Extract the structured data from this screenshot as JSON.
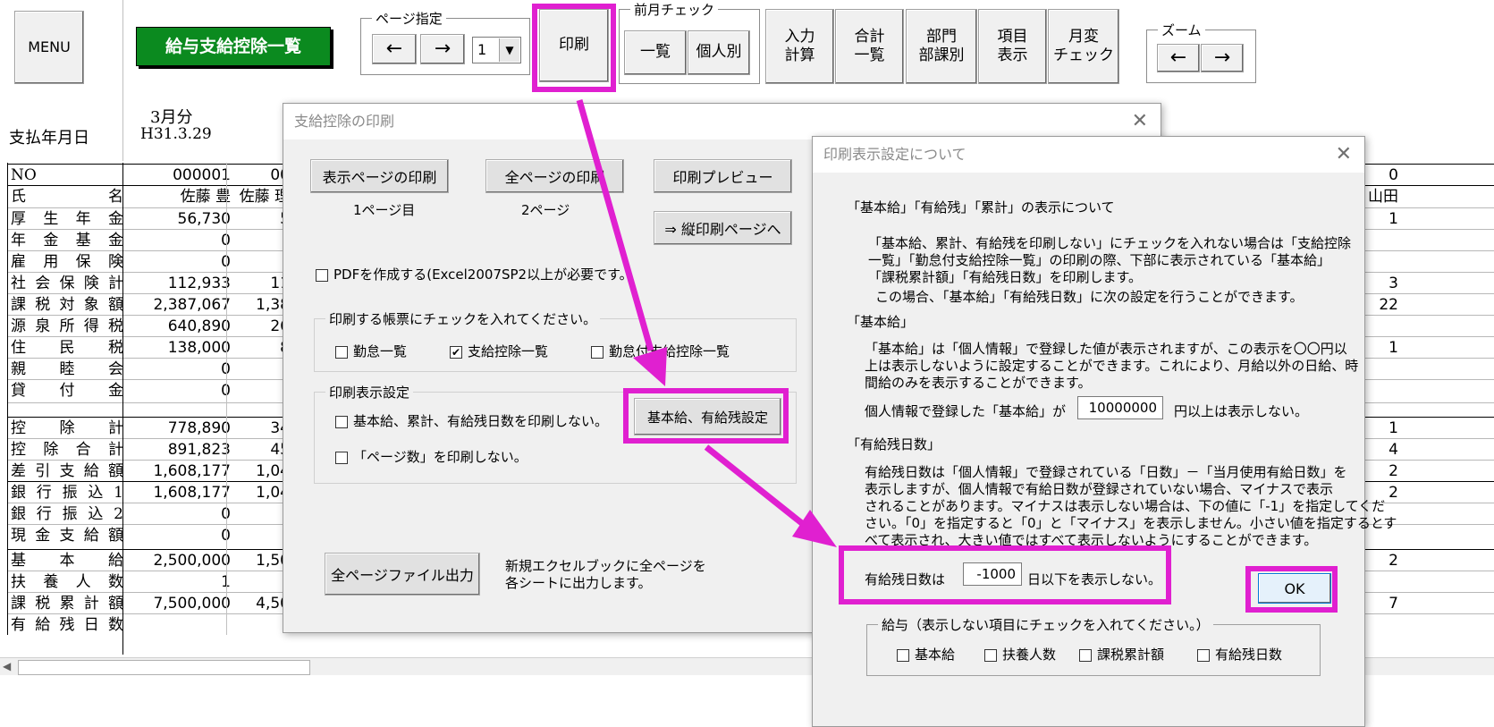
{
  "toolbar": {
    "menu": "MENU",
    "sheet_title": "給与支給控除一覧",
    "page_group": "ページ指定",
    "prev_arrow": "←",
    "next_arrow": "→",
    "page_value": "1",
    "print": "印刷",
    "prev_month_group": "前月チェック",
    "list": "一覧",
    "individual": "個人別",
    "input_calc_1": "入力",
    "input_calc_2": "計算",
    "total_list_1": "合計",
    "total_list_2": "一覧",
    "dept_1": "部門",
    "dept_2": "部課別",
    "item_show_1": "項目",
    "item_show_2": "表示",
    "monthly_1": "月変",
    "monthly_2": "チェック",
    "zoom_group": "ズーム",
    "zoom_left": "←",
    "zoom_right": "→"
  },
  "sheet": {
    "month": "3月分",
    "pay_date_label": "支払年月日",
    "pay_date": "H31.3.29",
    "rows": [
      {
        "label": "NO",
        "v1": "000001",
        "v2": "00",
        "v3": "0"
      },
      {
        "label": "氏名",
        "v1": "佐藤 豊",
        "v2": "佐藤 理",
        "v3": "山田"
      },
      {
        "label": "厚生年金",
        "v1": "56,730",
        "v2": "5",
        "v3": "1"
      },
      {
        "label": "年金基金",
        "v1": "0",
        "v2": "",
        "v3": ""
      },
      {
        "label": "雇用保険",
        "v1": "0",
        "v2": "",
        "v3": ""
      },
      {
        "label": "社会保険計",
        "v1": "112,933",
        "v2": "11",
        "v3": "3"
      },
      {
        "label": "課税対象額",
        "v1": "2,387,067",
        "v2": "1,38",
        "v3": "22"
      },
      {
        "label": "源泉所得税",
        "v1": "640,890",
        "v2": "26",
        "v3": ""
      },
      {
        "label": "住民税",
        "v1": "138,000",
        "v2": "8",
        "v3": "1"
      },
      {
        "label": "親睦会",
        "v1": "0",
        "v2": "",
        "v3": ""
      },
      {
        "label": "貸付金",
        "v1": "0",
        "v2": "",
        "v3": ""
      },
      {
        "label": "",
        "v1": "",
        "v2": "",
        "v3": ""
      },
      {
        "label": "控除計",
        "v1": "778,890",
        "v2": "34",
        "v3": "1"
      },
      {
        "label": "控除合計",
        "v1": "891,823",
        "v2": "45",
        "v3": "4"
      },
      {
        "label": "差引支給額",
        "v1": "1,608,177",
        "v2": "1,04",
        "v3": "2"
      },
      {
        "label": "銀行振込1",
        "v1": "1,608,177",
        "v2": "1,04",
        "v3": "2"
      },
      {
        "label": "銀行振込2",
        "v1": "0",
        "v2": "",
        "v3": ""
      },
      {
        "label": "現金支給額",
        "v1": "0",
        "v2": "",
        "v3": ""
      },
      {
        "label": "基本給",
        "v1": "2,500,000",
        "v2": "1,50",
        "v3": "2"
      },
      {
        "label": "扶養人数",
        "v1": "1",
        "v2": "",
        "v3": ""
      },
      {
        "label": "課税累計額",
        "v1": "7,500,000",
        "v2": "4,50",
        "v3": "7"
      },
      {
        "label": "有給残日数",
        "v1": "",
        "v2": "",
        "v3": ""
      }
    ]
  },
  "print_dialog": {
    "title": "支給控除の印刷",
    "close": "✕",
    "print_current": "表示ページの印刷",
    "print_all": "全ページの印刷",
    "preview": "印刷プレビュー",
    "current_page_note": "1ページ目",
    "all_pages_note": "2ページ",
    "portrait": "⇒ 縦印刷ページへ",
    "pdf_option": "PDFを作成する(Excel2007SP2以上が必要です。",
    "form_group": "印刷する帳票にチェックを入れてください。",
    "form_attendance": "勤怠一覧",
    "form_payroll": "支給控除一覧",
    "form_both": "勤怠付支給控除一覧",
    "settings_group": "印刷表示設定",
    "opt_no_base": "基本給、累計、有給残日数を印刷しない。",
    "opt_no_pages": "「ページ数」を印刷しない。",
    "base_paid_button": "基本給、有給残設定",
    "export_all": "全ページファイル出力",
    "export_note_1": "新規エクセルブックに全ページを",
    "export_note_2": "各シートに出力します。"
  },
  "settings_dialog": {
    "title": "印刷表示設定について",
    "close": "✕",
    "heading1": "「基本給」「有給残」「累計」の表示について",
    "para1_1": "「基本給、累計、有給残を印刷しない」にチェックを入れない場合は「支給控除",
    "para1_2": "一覧」「勤怠付支給控除一覧」の印刷の際、下部に表示されている「基本給」",
    "para1_3": "「課税累計額」「有給残日数」を印刷します。",
    "para2": "この場合、「基本給」「有給残日数」に次の設定を行うことができます。",
    "heading2": "「基本給」",
    "para3_1": "「基本給」は「個人情報」で登録した値が表示されますが、この表示を〇〇円以",
    "para3_2": "上は表示しないように設定することができます。これにより、月給以外の日給、時",
    "para3_3": "間給のみを表示することができます。",
    "base_pre": "個人情報で登録した「基本給」が",
    "base_value": "10000000",
    "base_post": "円以上は表示しない。",
    "heading3": "「有給残日数」",
    "para4_1": "有給残日数は「個人情報」で登録されている「日数」－「当月使用有給日数」を",
    "para4_2": "表示しますが、個人情報で有給日数が登録されていない場合、マイナスで表示",
    "para4_3": "されることがあります。マイナスは表示しない場合は、下の値に「-1」を指定してくだ",
    "para4_4": "さい。「0」を指定すると「0」と「マイナス」を表示しません。小さい値を指定するとす",
    "para4_5": "べて表示され、大きい値ではすべて表示しないようにすることができます。",
    "paid_pre": "有給残日数は",
    "paid_value": "-1000",
    "paid_post": "日以下を表示しない。",
    "ok": "OK",
    "hide_group": "給与（表示しない項目にチェックを入れてください。）",
    "hide_base": "基本給",
    "hide_dependents": "扶養人数",
    "hide_taxable": "課税累計額",
    "hide_paid": "有給残日数"
  },
  "colors": {
    "highlight": "#e020d0",
    "title_green": "#0b8a1f"
  }
}
